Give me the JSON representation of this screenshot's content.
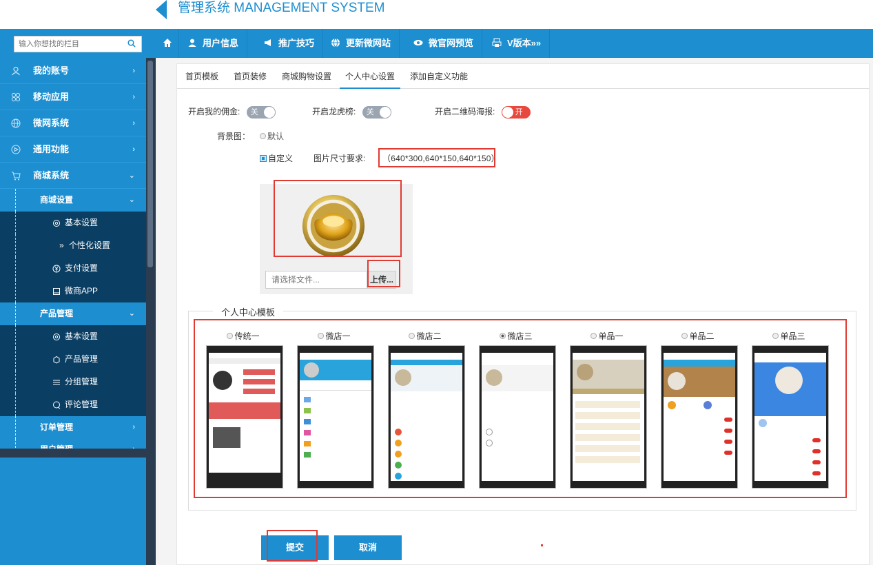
{
  "header": {
    "title": "管理系统 MANAGEMENT SYSTEM"
  },
  "sidebar": {
    "search_placeholder": "输入你想找的栏目",
    "menu": [
      {
        "label": "我的账号",
        "icon": "user-icon"
      },
      {
        "label": "移动应用",
        "icon": "apps-icon"
      },
      {
        "label": "微网系统",
        "icon": "globe-icon"
      },
      {
        "label": "通用功能",
        "icon": "video-icon"
      },
      {
        "label": "商城系统",
        "icon": "cart-icon"
      }
    ],
    "groups": [
      {
        "label": "商城设置",
        "children": [
          "基本设置",
          "个性化设置",
          "支付设置",
          "微商APP"
        ]
      },
      {
        "label": "产品管理",
        "children": [
          "基本设置",
          "产品管理",
          "分组管理",
          "评论管理"
        ]
      },
      {
        "label": "订单管理"
      },
      {
        "label": "用户管理"
      }
    ],
    "arrow_right": "›",
    "arrow_down": "⌄",
    "leaf_prefix": "»"
  },
  "topnav": {
    "items": [
      "用户信息",
      "推广技巧",
      "更新微网站",
      "微官网预览",
      "V版本»»"
    ]
  },
  "tabs": [
    "首页模板",
    "首页装修",
    "商城购物设置",
    "个人中心设置",
    "添加自定义功能"
  ],
  "active_tab": "个人中心设置",
  "settings": {
    "commission_label": "开启我的佣金:",
    "commission_state": "关",
    "ranking_label": "开启龙虎榜:",
    "ranking_state": "关",
    "qrcode_label": "开启二维码海报:",
    "qrcode_state": "开",
    "bg_label": "背景图：",
    "bg_default": "默认",
    "bg_custom": "自定义",
    "size_label": "图片尺寸要求:",
    "size_value": "（640*300,640*150,640*150）",
    "file_placeholder": "请选择文件...",
    "upload_button": "上传..."
  },
  "templates": {
    "legend": "个人中心模板",
    "options": [
      "传统一",
      "微店一",
      "微店二",
      "微店三",
      "单品一",
      "单品二",
      "单品三"
    ],
    "selected": "微店三"
  },
  "actions": {
    "submit": "提交",
    "cancel": "取消"
  },
  "colors": {
    "primary": "#1d8fd1",
    "sidebar_dark": "#0b3e63",
    "highlight_red": "#e03a32"
  }
}
